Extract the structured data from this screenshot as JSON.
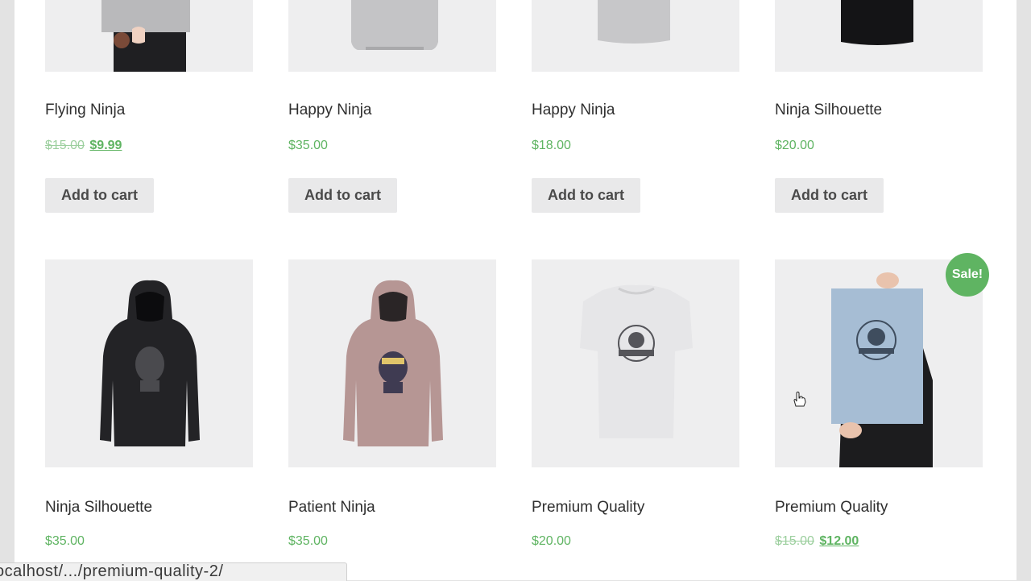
{
  "products": [
    {
      "title": "Flying Ninja",
      "price_regular": "$15.00",
      "price_sale": "$9.99",
      "button": "Add to cart",
      "image": "poster-held-by-person"
    },
    {
      "title": "Happy Ninja",
      "price": "$35.00",
      "button": "Add to cart",
      "image": "grey-hoodie"
    },
    {
      "title": "Happy Ninja",
      "price": "$18.00",
      "button": "Add to cart",
      "image": "grey-tshirt"
    },
    {
      "title": "Ninja Silhouette",
      "price": "$20.00",
      "button": "Add to cart",
      "image": "black-tshirt"
    },
    {
      "title": "Ninja Silhouette",
      "price": "$35.00",
      "image": "black-hoodie-ninja"
    },
    {
      "title": "Patient Ninja",
      "price": "$35.00",
      "image": "pink-hoodie-ninja"
    },
    {
      "title": "Premium Quality",
      "price": "$20.00",
      "image": "white-tshirt-woothemes"
    },
    {
      "title": "Premium Quality",
      "price_regular": "$15.00",
      "price_sale": "$12.00",
      "badge": "Sale!",
      "image": "blue-poster-woothemes"
    }
  ],
  "status_bar": {
    "url": "ocalhost/.../premium-quality-2/"
  },
  "colors": {
    "accent": "#5fb462",
    "thumb_bg": "#eeeeef",
    "button_bg": "#e9e9ea"
  }
}
